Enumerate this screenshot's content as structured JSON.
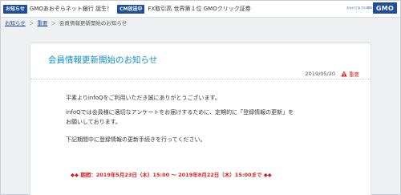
{
  "topbar": {
    "news_tag": "お知らせ",
    "news_text": "GMOあおぞらネット銀行 誕生！",
    "cm_tag": "CM放送中",
    "cm_text": "FX取引高 世界第１位 GMOクリック証券",
    "logo_tagline": "おかげさまで23周年",
    "logo_text": "GMO"
  },
  "breadcrumb": {
    "items": [
      "お知らせ",
      "重要",
      "会員情報更新開始のお知らせ"
    ],
    "separator": "＞"
  },
  "notice": {
    "title": "会員情報更新開始のお知らせ",
    "date": "2019/05/20",
    "importance_label": "重要",
    "paragraph_1": "平素よりinfoQをご利用いただき誠にありがとうございます。",
    "paragraph_2_line_1": "infoQでは会員様に適切なアンケートをお届けするために、定期的に「登録情報の更新」を",
    "paragraph_2_line_2": "お願いしております。",
    "paragraph_3": "下記期間中に登録情報の更新手続きを行ってください。",
    "period": "◆◆ 期間：2019年5月23日（木）15:00 ～ 2019年8月22日（木）15:00まで ◆◆"
  },
  "colors": {
    "brand_blue": "#1f4d9b",
    "title_blue": "#0e8fc9",
    "important_red": "#d3271f",
    "period_red": "#e11b1b"
  }
}
